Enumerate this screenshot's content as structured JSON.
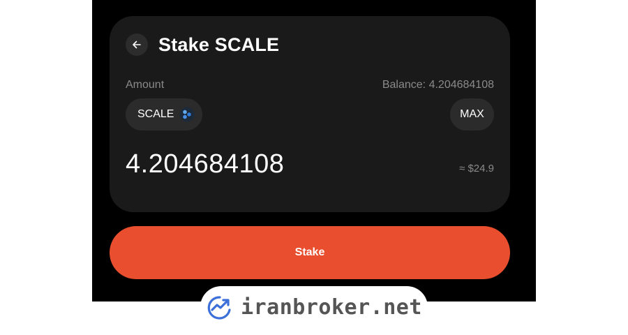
{
  "header": {
    "title": "Stake SCALE",
    "back_icon": "arrow-left-icon"
  },
  "amount_section": {
    "label": "Amount",
    "balance_text": "Balance: 4.204684108",
    "token": {
      "symbol": "SCALE",
      "icon": "scale-token-icon"
    },
    "max_label": "MAX",
    "amount_value": "4.204684108",
    "usd_equivalent": "≈ $24.9"
  },
  "action": {
    "stake_label": "Stake"
  },
  "watermark": {
    "text": "iranbroker.net",
    "icon": "trend-chart-logo-icon"
  },
  "colors": {
    "background": "#000000",
    "card": "#1a1a1a",
    "chip": "#2b2b2b",
    "accent": "#e94f2f",
    "muted_text": "#8a8a8a",
    "watermark_blue": "#3b6fd9"
  }
}
